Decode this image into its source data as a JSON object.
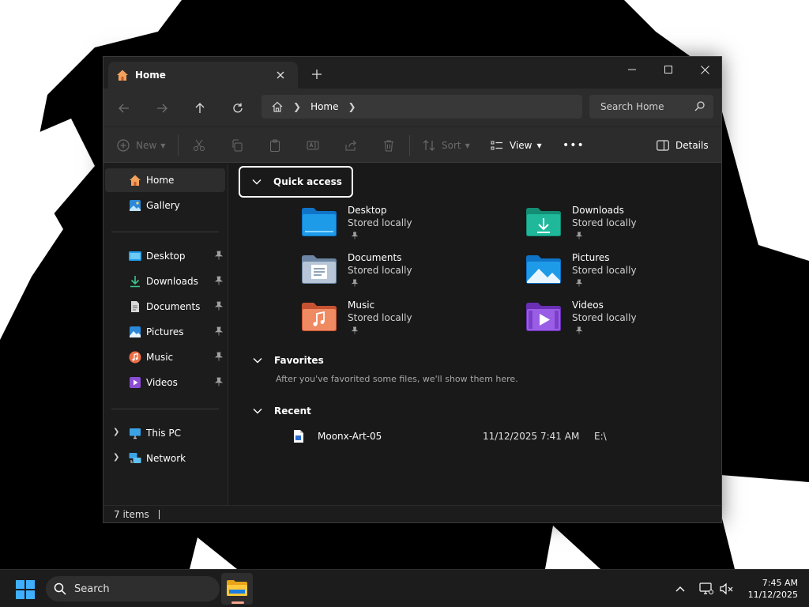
{
  "window": {
    "tab_title": "Home",
    "tab_close_icon": "close-icon",
    "tab_add_icon": "plus-icon"
  },
  "address_bar": {
    "crumbs": [
      "Home"
    ],
    "search_placeholder": "Search Home"
  },
  "toolbar": {
    "new_label": "New",
    "sort_label": "Sort",
    "view_label": "View",
    "more_label": "•••",
    "details_label": "Details"
  },
  "sidebar": {
    "top_items": [
      {
        "label": "Home",
        "icon": "home-icon",
        "active": true
      },
      {
        "label": "Gallery",
        "icon": "gallery-icon"
      }
    ],
    "pinned_items": [
      {
        "label": "Desktop",
        "icon": "desktop-folder-icon"
      },
      {
        "label": "Downloads",
        "icon": "downloads-icon"
      },
      {
        "label": "Documents",
        "icon": "documents-icon"
      },
      {
        "label": "Pictures",
        "icon": "pictures-icon"
      },
      {
        "label": "Music",
        "icon": "music-icon"
      },
      {
        "label": "Videos",
        "icon": "videos-icon"
      }
    ],
    "drive_items": [
      {
        "label": "This PC",
        "icon": "this-pc-icon"
      },
      {
        "label": "Network",
        "icon": "network-icon"
      }
    ]
  },
  "main": {
    "quick_access": {
      "header": "Quick access",
      "folders": [
        {
          "name": "Desktop",
          "status": "Stored locally",
          "icon": "desktop-folder-icon",
          "color": "#1e9be8"
        },
        {
          "name": "Downloads",
          "status": "Stored locally",
          "icon": "downloads-folder-icon",
          "color": "#1fb89a"
        },
        {
          "name": "Documents",
          "status": "Stored locally",
          "icon": "documents-folder-icon",
          "color": "#8aa3bf"
        },
        {
          "name": "Pictures",
          "status": "Stored locally",
          "icon": "pictures-folder-icon",
          "color": "#1e9be8"
        },
        {
          "name": "Music",
          "status": "Stored locally",
          "icon": "music-folder-icon",
          "color": "#ea6e47"
        },
        {
          "name": "Videos",
          "status": "Stored locally",
          "icon": "videos-folder-icon",
          "color": "#8b4dd8"
        }
      ]
    },
    "favorites": {
      "header": "Favorites",
      "empty_note": "After you've favorited some files, we'll show them here."
    },
    "recent": {
      "header": "Recent",
      "files": [
        {
          "name": "Moonx-Art-05",
          "date": "11/12/2025 7:41 AM",
          "location": "E:\\"
        }
      ]
    }
  },
  "status_bar": {
    "item_count": "7 items"
  },
  "taskbar": {
    "search_placeholder": "Search",
    "time": "7:45 AM",
    "date": "11/12/2025"
  }
}
